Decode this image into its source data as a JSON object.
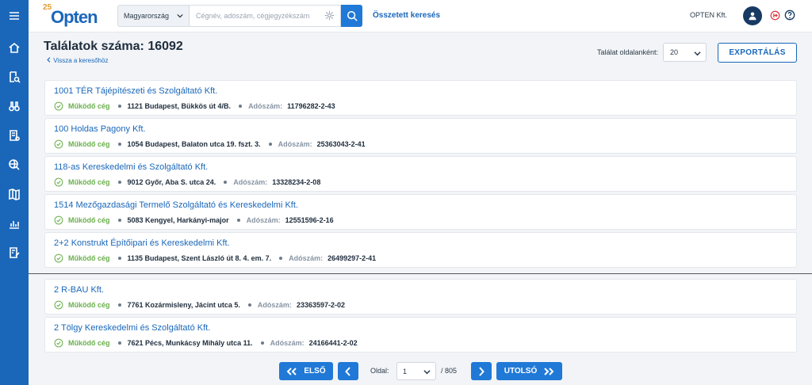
{
  "header": {
    "logo_sup": "25",
    "logo_text": "Opten",
    "country": "Magyarország",
    "search_placeholder": "Cégnév, adószám, cégjegyzékszám",
    "advanced_search": "Összetett keresés",
    "company": "OPTEN Kft."
  },
  "sidebar": {
    "icons": [
      "menu-icon",
      "home-icon",
      "document-search-icon",
      "binoculars-icon",
      "document-list-icon",
      "globe-search-icon",
      "map-icon",
      "chart-icon",
      "document-edit-icon"
    ]
  },
  "results": {
    "title": "Találatok száma: 16092",
    "back_link": "Vissza a keresőhöz",
    "per_page_label": "Találat oldalanként:",
    "per_page_value": "20",
    "export_label": "EXPORTÁLÁS",
    "tax_label": "Adószám:",
    "items": [
      {
        "name": "1001 TÉR Tájépítészeti és Szolgáltató Kft.",
        "status": "Működő cég",
        "address": "1121 Budapest, Bükkös út 4/B.",
        "tax": "11796282-2-43"
      },
      {
        "name": "100 Holdas Pagony Kft.",
        "status": "Működő cég",
        "address": "1054 Budapest, Balaton utca 19. fszt. 3.",
        "tax": "25363043-2-41"
      },
      {
        "name": "118-as Kereskedelmi és Szolgáltató Kft.",
        "status": "Működő cég",
        "address": "9012 Győr, Aba S. utca 24.",
        "tax": "13328234-2-08"
      },
      {
        "name": "1514 Mezőgazdasági Termelő Szolgáltató és Kereskedelmi Kft.",
        "status": "Működő cég",
        "address": "5083 Kengyel, Harkányi-major",
        "tax": "12551596-2-16"
      },
      {
        "name": "2+2 Konstrukt Építőipari és Kereskedelmi Kft.",
        "status": "Működő cég",
        "address": "1135 Budapest, Szent László út 8. 4. em. 7.",
        "tax": "26499297-2-41"
      },
      {
        "name": "2 R-BAU Kft.",
        "status": "Működő cég",
        "address": "7761 Kozármisleny, Jácint utca 5.",
        "tax": "23363597-2-02"
      },
      {
        "name": "2 Tölgy Kereskedelmi és Szolgáltató Kft.",
        "status": "Működő cég",
        "address": "7621 Pécs, Munkácsy Mihály utca 11.",
        "tax": "24166441-2-02"
      }
    ]
  },
  "pagination": {
    "first": "ELSŐ",
    "last": "UTOLSÓ",
    "page_label": "Oldal:",
    "page_value": "1",
    "total": "/ 805"
  },
  "colors": {
    "primary": "#1a67ba",
    "button": "#2079d6",
    "status_green": "#6ab04c",
    "logo_orange": "#e59a2c"
  }
}
